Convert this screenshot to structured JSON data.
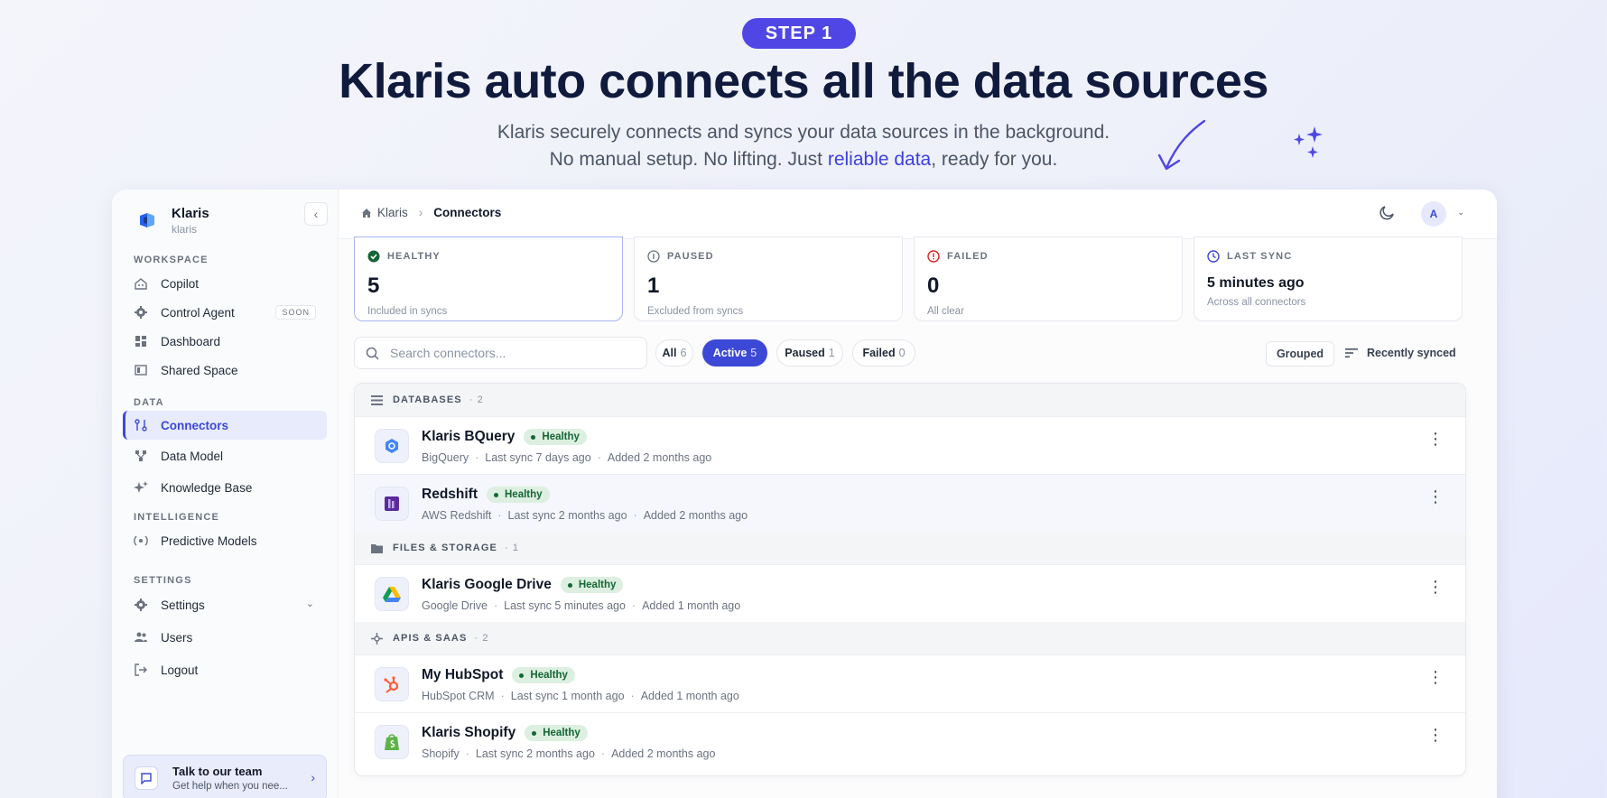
{
  "hero": {
    "step": "STEP 1",
    "title": "Klaris auto connects all the data sources",
    "subtitle_line1": "Klaris securely connects and syncs your data sources in the background.",
    "subtitle_line2_pre": "No manual setup. No lifting. Just ",
    "subtitle_line2_accent": "reliable data",
    "subtitle_line2_post": ", ready for you."
  },
  "sidebar": {
    "brand_name": "Klaris",
    "brand_sub": "klaris",
    "sections": {
      "workspace": "WORKSPACE",
      "data": "DATA",
      "intelligence": "INTELLIGENCE",
      "settings": "SETTINGS"
    },
    "items": {
      "copilot": "Copilot",
      "control_agent": "Control Agent",
      "soon": "SOON",
      "dashboard": "Dashboard",
      "shared_space": "Shared Space",
      "connectors": "Connectors",
      "data_model": "Data Model",
      "knowledge_base": "Knowledge Base",
      "predictive_models": "Predictive Models",
      "settings": "Settings",
      "users": "Users",
      "logout": "Logout"
    },
    "help": {
      "title": "Talk to our team",
      "subtitle": "Get help when you nee..."
    }
  },
  "topbar": {
    "breadcrumb_root": "Klaris",
    "breadcrumb_current": "Connectors",
    "avatar_initial": "A"
  },
  "stats": {
    "healthy": {
      "label": "HEALTHY",
      "value": "5",
      "hint": "Included in syncs"
    },
    "paused": {
      "label": "PAUSED",
      "value": "1",
      "hint": "Excluded from syncs"
    },
    "failed": {
      "label": "FAILED",
      "value": "0",
      "hint": "All clear"
    },
    "last_sync": {
      "label": "LAST SYNC",
      "value": "5 minutes ago",
      "hint": "Across all connectors"
    }
  },
  "toolbar": {
    "search_placeholder": "Search connectors...",
    "filters": {
      "all": {
        "label": "All",
        "count": "6"
      },
      "active": {
        "label": "Active",
        "count": "5"
      },
      "paused": {
        "label": "Paused",
        "count": "1"
      },
      "failed": {
        "label": "Failed",
        "count": "0"
      }
    },
    "grouped": "Grouped",
    "sort": "Recently synced"
  },
  "groups": {
    "databases": {
      "label": "DATABASES",
      "count": "· 2"
    },
    "files": {
      "label": "FILES & STORAGE",
      "count": "· 1"
    },
    "apis": {
      "label": "APIS & SAAS",
      "count": "· 2"
    }
  },
  "connectors": [
    {
      "name": "Klaris BQuery",
      "status": "Healthy",
      "source": "BigQuery",
      "last_sync": "Last sync 7 days ago",
      "added": "Added 2 months ago"
    },
    {
      "name": "Redshift",
      "status": "Healthy",
      "source": "AWS Redshift",
      "last_sync": "Last sync 2 months ago",
      "added": "Added 2 months ago"
    },
    {
      "name": "Klaris Google Drive",
      "status": "Healthy",
      "source": "Google Drive",
      "last_sync": "Last sync 5 minutes ago",
      "added": "Added 1 month ago"
    },
    {
      "name": "My HubSpot",
      "status": "Healthy",
      "source": "HubSpot CRM",
      "last_sync": "Last sync 1 month ago",
      "added": "Added 1 month ago"
    },
    {
      "name": "Klaris Shopify",
      "status": "Healthy",
      "source": "Shopify",
      "last_sync": "Last sync 2 months ago",
      "added": "Added 2 months ago"
    }
  ],
  "colors": {
    "accent": "#3b49d6",
    "hero_pill": "#4f46e5",
    "healthy_bg": "#dcefe0",
    "healthy_text": "#166534",
    "failed": "#e02424"
  }
}
